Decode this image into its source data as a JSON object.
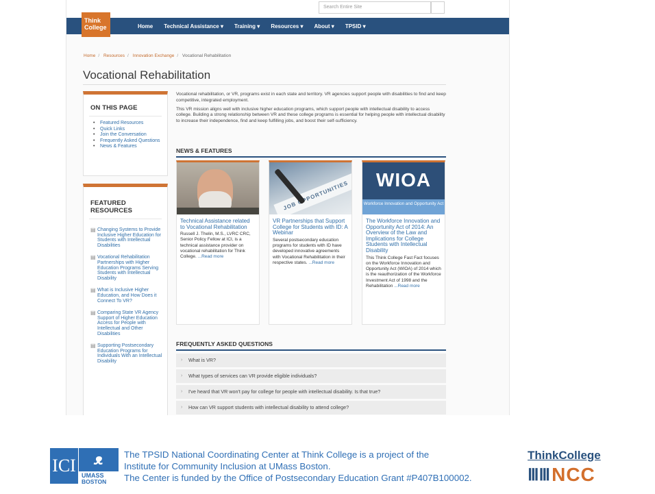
{
  "site": {
    "search_placeholder": "Search Entire Site",
    "logo_line1": "Think",
    "logo_line2": "College"
  },
  "nav": {
    "items": [
      "Home",
      "Technical Assistance ▾",
      "Training ▾",
      "Resources ▾",
      "About ▾",
      "TPSID ▾"
    ]
  },
  "breadcrumb": {
    "items": [
      "Home",
      "Resources",
      "Innovation Exchange"
    ],
    "current": "Vocational Rehabilitation"
  },
  "page_title": "Vocational Rehabilitation",
  "on_this_page": {
    "heading": "ON THIS PAGE",
    "links": [
      "Featured Resources",
      "Quick Links",
      "Join the Conversation",
      "Frequently Asked Questions",
      "News & Features"
    ]
  },
  "featured_resources": {
    "heading": "FEATURED RESOURCES",
    "items": [
      "Changing Systems to Provide Inclusive Higher Education for Students with Intellectual Disabilities",
      "Vocational Rehabilitation Partnerships with Higher Education Programs Serving Students with Intellectual Disability",
      "What is Inclusive Higher Education, and How Does it Connect To VR?",
      "Comparing State VR Agency Support of Higher Education Access for People with Intellectual and Other Disabilities",
      "Supporting Postsecondary Education Programs for Individuals With an Intellectual Disability"
    ]
  },
  "intro": {
    "p1": "Vocational rehabilitation, or VR, programs exist in each state and territory. VR agencies support people with disabilities to find and keep competitive, integrated employment.",
    "p2": "This VR mission aligns well with inclusive higher education programs, which support people with intellectual disability to access college. Building a strong relationship between VR and these college programs is essential for helping people with intellectual disability to increase their independence, find and keep fulfilling jobs, and boost their self-sufficiency."
  },
  "news": {
    "heading": "NEWS & FEATURES",
    "cards": [
      {
        "title": "Technical Assistance related to Vocational Rehabilitation",
        "body": "Russell J. Thelin, M.S., LVRC CRC, Senior Policy Fellow at ICI, is a technical assistance provider on vocational rehabilitation for Think College.",
        "read_more": "...Read more"
      },
      {
        "title": "VR Partnerships that Support College for Students with ID: A Webinar",
        "body": "Several postsecondary education programs for students with ID have developed innovative agreements with Vocational Rehabilitation in their respective states.",
        "read_more": "...Read more",
        "image_text": "JOB OPPORTUNITIES"
      },
      {
        "title": "The Workforce Innovation and Opportunity Act of 2014: An Overview of the Law and Implications for College Students with Intellectual Disability",
        "body": "This Think College Fast Fact focuses on the Workforce Innovation and Opportunity Act (WIOA) of 2014 which is the reauthorization of the Workforce Investment Act of 1998 and the Rehabilitation",
        "read_more": "...Read more",
        "image_big": "WIOA",
        "image_band": "Workforce Innovation and Opportunity Act"
      }
    ]
  },
  "faq": {
    "heading": "FREQUENTLY ASKED QUESTIONS",
    "items": [
      "What is VR?",
      "What types of services can VR provide eligible individuals?",
      "I've heard that VR won't pay for college for people with intellectual disability. Is that true?",
      "How can VR support students with intellectual disability to attend college?"
    ]
  },
  "footer": {
    "ici": "ICI",
    "umass_line1": "UMASS",
    "umass_line2": "BOSTON",
    "line1": "The TPSID National Coordinating Center at Think College is a project of the",
    "line2": "Institute for Community Inclusion at UMass Boston.",
    "line3": "The Center is funded by the Office of Postsecondary Education Grant #P407B100002.",
    "tc_top": "ThinkCollege",
    "tc_ncc": "NCC"
  }
}
